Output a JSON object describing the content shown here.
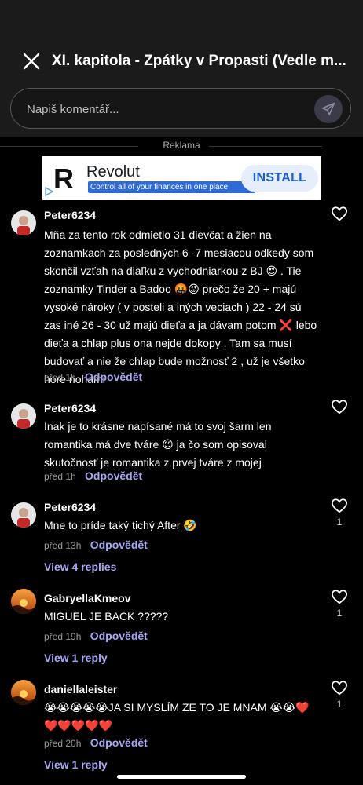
{
  "header": {
    "title": "XI. kapitola - Zpátky v Propasti (Vedle m..."
  },
  "composer": {
    "placeholder": "Napiš komentář..."
  },
  "ad": {
    "label": "Reklama",
    "brand": "Revolut",
    "tagline": "Control all of your finances in one place",
    "cta": "INSTALL",
    "logo_letter": "R"
  },
  "comments": [
    {
      "username": "Peter6234",
      "text": "Mňa za tento rok odmietlo 31 dievčat a žien na zoznamkach za posledných 6 -7 mesiacou odkedy som skončil vzťah na diaľku z vychodniarkou z BJ 😍 . Tie zoznamky Tinder a Badoo 🤬😡 prečo že 20 + majú vysoké nároky ( v posteli a iných veciach ) 22 - 24 sú zas iné 26 - 30 už majú dieťa a ja dávam potom ❌ lebo dieťa a chlap plus ona nejde dokopy . Tam sa musí budovať a nie že chlap bude možnosť 2 , už je všetko hore nohami",
      "time": "před 1h",
      "reply_label": "Odpovědět",
      "likes": ""
    },
    {
      "username": "Peter6234",
      "text": "Inak je to krásne napísané má to svoj šarm len romantika má dve tváre 😊 ja čo som opisoval skutočnosť je romantika z prvej tváre z mojej",
      "time": "před 1h",
      "reply_label": "Odpovědět",
      "likes": ""
    },
    {
      "username": "Peter6234",
      "text": "Mne to príde taký tichý After 🤣",
      "time": "před 13h",
      "reply_label": "Odpovědět",
      "likes": "1",
      "view_replies": "View 4 replies"
    },
    {
      "username": "GabryellaKmeov",
      "text": "MIGUEL JE BACK ?????",
      "time": "před 19h",
      "reply_label": "Odpovědět",
      "likes": "1",
      "view_replies": "View 1 reply"
    },
    {
      "username": "daniellaleister",
      "text": "😭😭😭😭😭JA SI MYSLÍM ZE TO JE MNAM 😭😭❤️❤️❤️❤️❤️❤️",
      "time": "před 20h",
      "reply_label": "Odpovědět",
      "likes": "1",
      "view_replies": "View 1 reply"
    }
  ],
  "colors": {
    "background": "#000000",
    "header": "#1b1b1b",
    "link": "#a7a7f5",
    "muted": "#9a9a9a"
  }
}
